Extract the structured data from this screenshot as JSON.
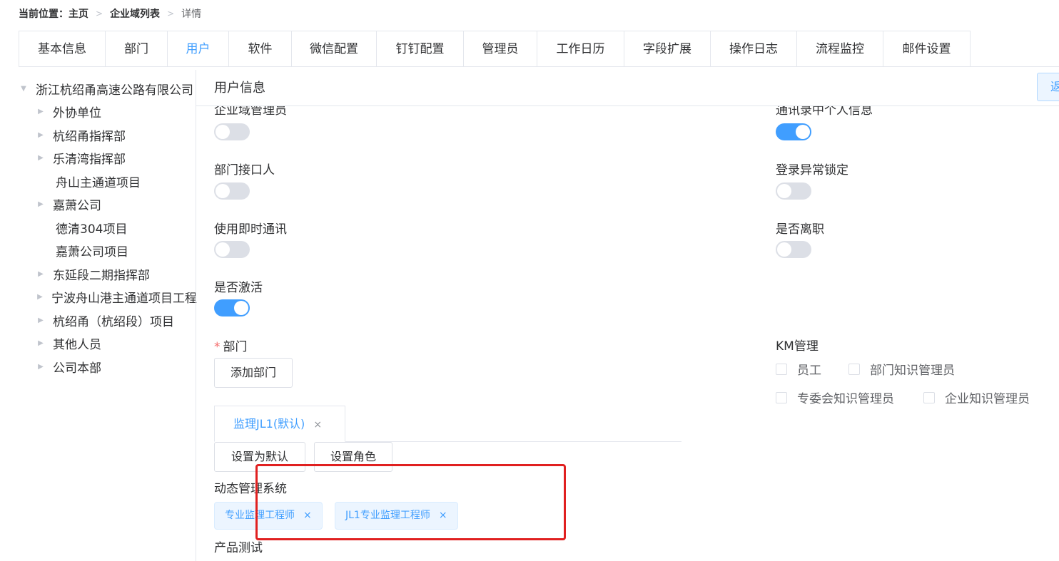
{
  "breadcrumb": {
    "label": "当前位置：",
    "items": [
      "主页",
      "企业域列表"
    ],
    "current": "详情"
  },
  "tabs": [
    "基本信息",
    "部门",
    "用户",
    "软件",
    "微信配置",
    "钉钉配置",
    "管理员",
    "工作日历",
    "字段扩展",
    "操作日志",
    "流程监控",
    "邮件设置"
  ],
  "active_tab": "用户",
  "tree": {
    "root": "浙江杭绍甬高速公路有限公司",
    "children": [
      {
        "label": "外协单位",
        "expandable": true
      },
      {
        "label": "杭绍甬指挥部",
        "expandable": true
      },
      {
        "label": "乐清湾指挥部",
        "expandable": true
      },
      {
        "label": "舟山主通道项目",
        "expandable": false
      },
      {
        "label": "嘉萧公司",
        "expandable": true
      },
      {
        "label": "德清304项目",
        "expandable": false
      },
      {
        "label": "嘉萧公司项目",
        "expandable": false
      },
      {
        "label": "东延段二期指挥部",
        "expandable": true
      },
      {
        "label": "宁波舟山港主通道项目工程",
        "expandable": true
      },
      {
        "label": "杭绍甬（杭绍段）项目",
        "expandable": true
      },
      {
        "label": "其他人员",
        "expandable": true
      },
      {
        "label": "公司本部",
        "expandable": true
      }
    ]
  },
  "panel": {
    "title": "用户信息",
    "back_label": "返回"
  },
  "switches": {
    "enterprise_admin": {
      "label": "企业域管理员",
      "on": false
    },
    "contact_personal_info": {
      "label": "通讯录中个人信息",
      "on": true
    },
    "dept_contact": {
      "label": "部门接口人",
      "on": false
    },
    "login_lock": {
      "label": "登录异常锁定",
      "on": false
    },
    "instant_msg": {
      "label": "使用即时通讯",
      "on": false
    },
    "resigned": {
      "label": "是否离职",
      "on": false
    },
    "activated": {
      "label": "是否激活",
      "on": true
    }
  },
  "department": {
    "label": "部门",
    "add_button": "添加部门",
    "tab_label": "监理JL1(默认)",
    "set_default_button": "设置为默认",
    "set_role_button": "设置角色"
  },
  "km": {
    "label": "KM管理",
    "options": [
      {
        "label": "员工",
        "checked": false
      },
      {
        "label": "部门知识管理员",
        "checked": false
      },
      {
        "label": "专委会知识管理员",
        "checked": false
      },
      {
        "label": "企业知识管理员",
        "checked": false
      }
    ]
  },
  "dynamic_system": {
    "label": "动态管理系统",
    "tags": [
      "专业监理工程师",
      "JL1专业监理工程师"
    ]
  },
  "product_test": {
    "label": "产品测试"
  },
  "colors": {
    "primary": "#409eff",
    "switch_off": "#dcdfe6",
    "highlight": "#e02020"
  },
  "icons": {
    "close": "×",
    "tree_expand": "▶",
    "tree_collapse": "▼",
    "breadcrumb_sep": ">"
  }
}
